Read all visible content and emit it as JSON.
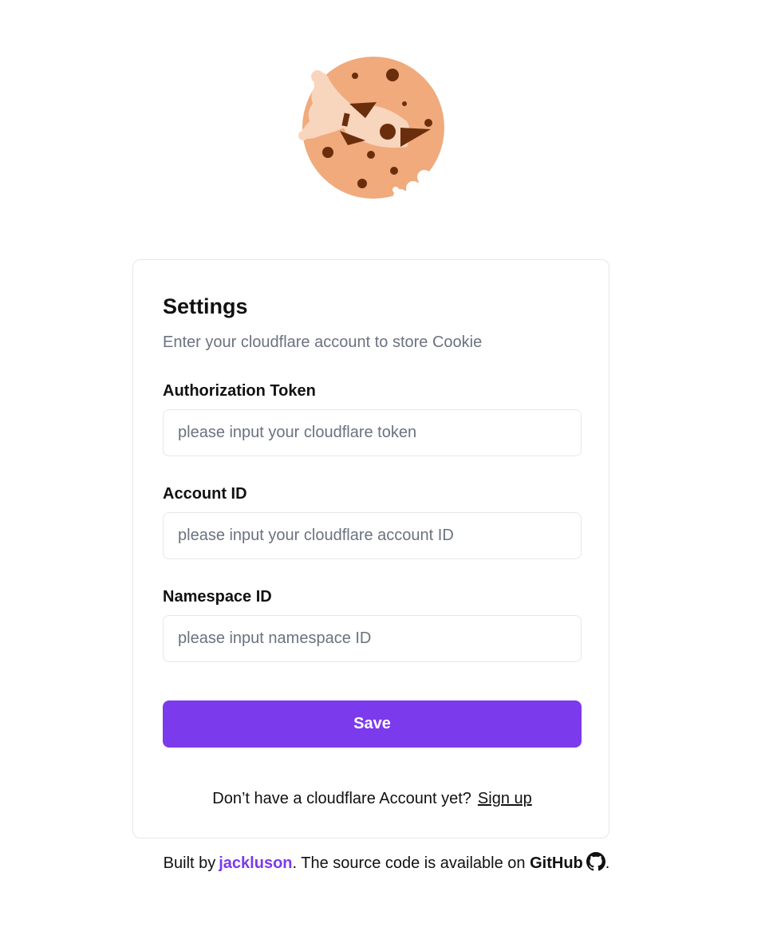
{
  "brand": {
    "logo_alt": "cookie rocket logo"
  },
  "settings": {
    "title": "Settings",
    "subtitle": "Enter your cloudflare account to store Cookie",
    "fields": [
      {
        "label": "Authorization Token",
        "placeholder": "please input your cloudflare token",
        "value": ""
      },
      {
        "label": "Account ID",
        "placeholder": "please input your cloudflare account ID",
        "value": ""
      },
      {
        "label": "Namespace ID",
        "placeholder": "please input namespace ID",
        "value": ""
      }
    ],
    "save_label": "Save",
    "signup_prompt": "Don’t have a cloudflare Account yet?",
    "signup_link": "Sign up"
  },
  "footer": {
    "built_by": "Built by",
    "author": "jackluson",
    "source_text": ". The source code is available on",
    "github_label": "GitHub",
    "end_punct": ".",
    "icon": "github-icon"
  },
  "colors": {
    "accent": "#7c3aed",
    "cookie": "#f0aa7c",
    "cookie_dark": "#6b2e0c",
    "cookie_light": "#f8d5bd"
  }
}
